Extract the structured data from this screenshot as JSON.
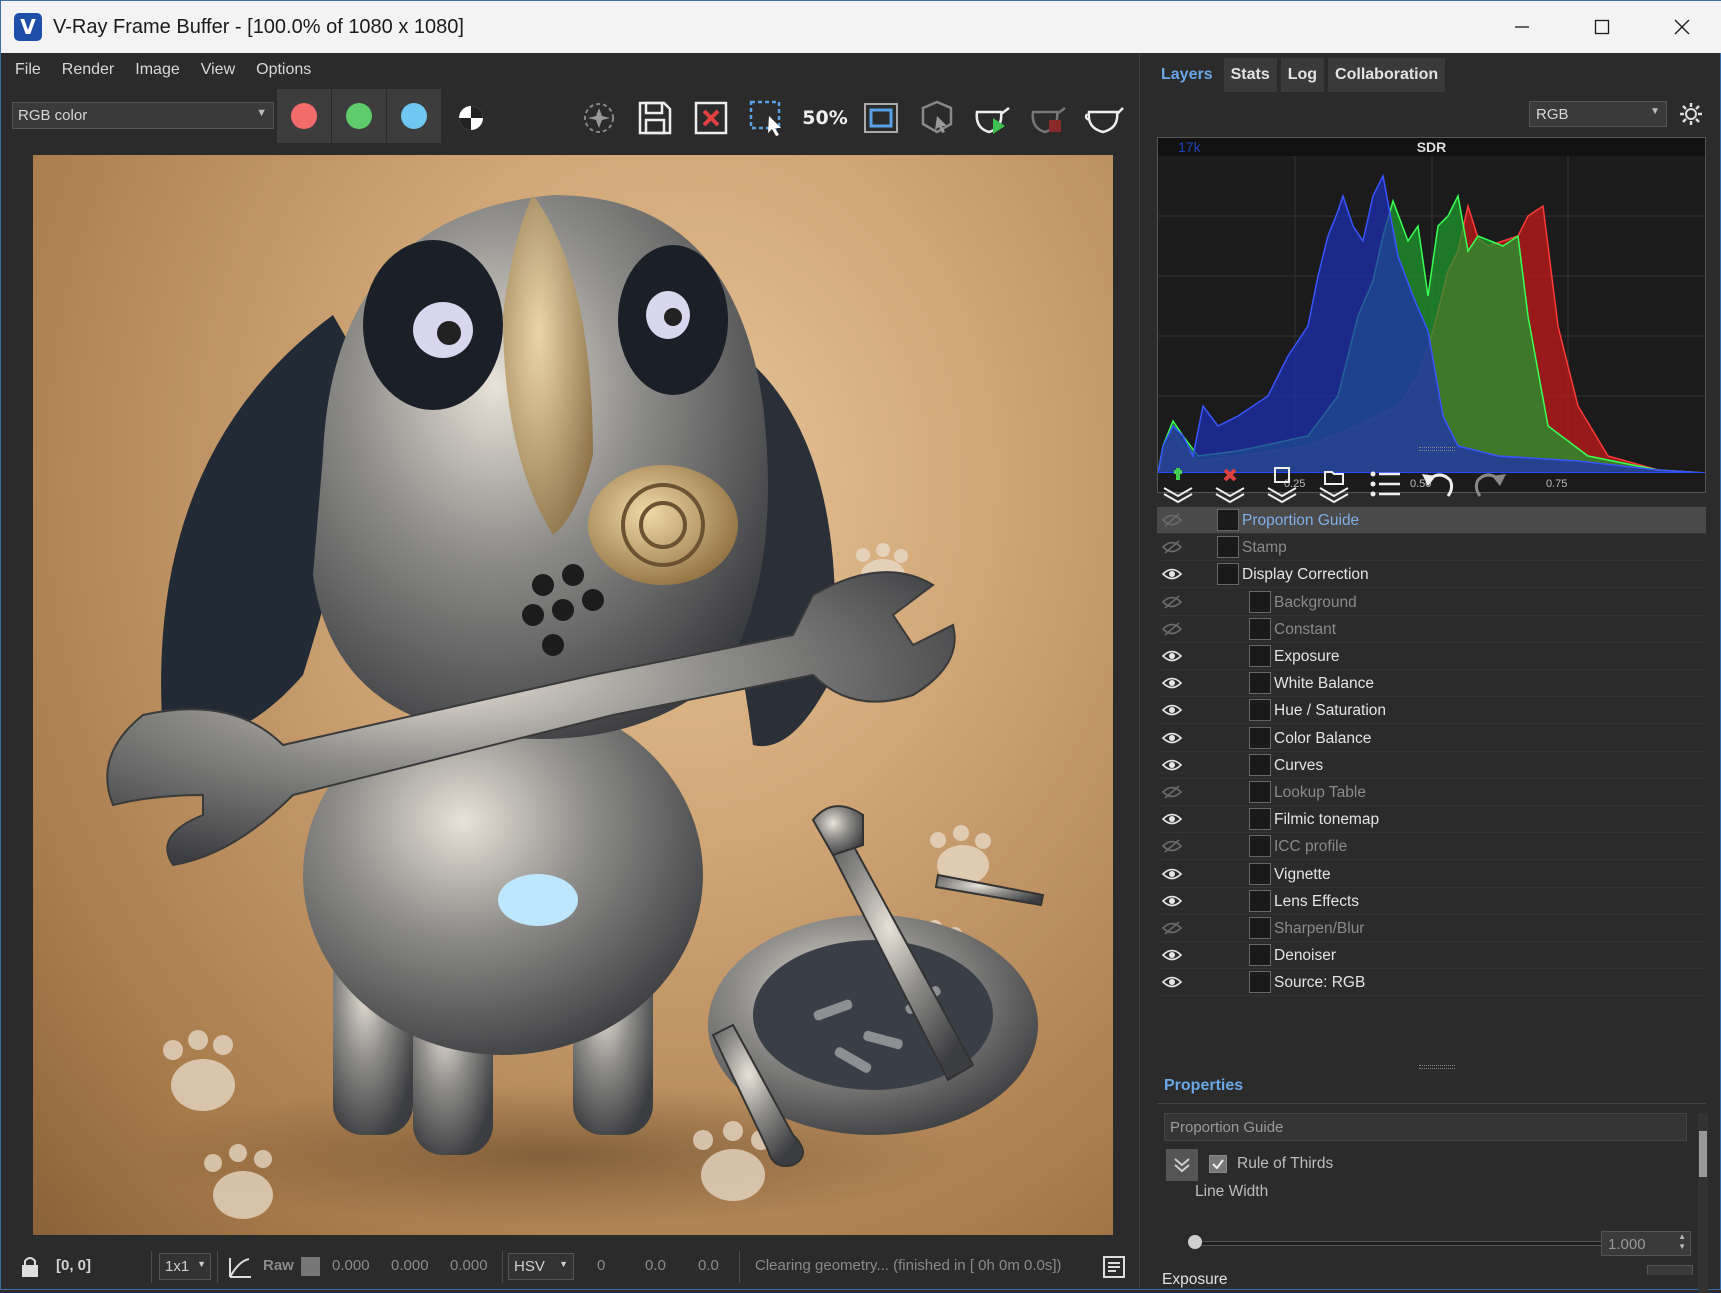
{
  "window": {
    "title": "V-Ray Frame Buffer - [100.0% of 1080 x 1080]",
    "logo_letter": "V"
  },
  "menu": [
    "File",
    "Render",
    "Image",
    "View",
    "Options"
  ],
  "toolbar": {
    "channel_value": "RGB color",
    "zoom_label": "50%",
    "colors": {
      "red": "#f26c6c",
      "green": "#5ecc6a",
      "blue": "#6ec8f2"
    }
  },
  "statusbar": {
    "coords": "[0, 0]",
    "sample_size": "1x1",
    "raw_label": "Raw",
    "rgb_values": [
      "0.000",
      "0.000",
      "0.000"
    ],
    "color_mode": "HSV",
    "hsv_values": [
      "0",
      "0.0",
      "0.0"
    ],
    "message": "Clearing geometry... (finished in [ 0h  0m  0.0s])"
  },
  "right_panel": {
    "tabs": [
      "Layers",
      "Stats",
      "Log",
      "Collaboration"
    ],
    "active_tab": "Layers",
    "histogram_channel": "RGB",
    "histogram": {
      "label": "SDR",
      "count": "17k",
      "ticks": [
        "0.25",
        "0.50",
        "0.75"
      ]
    },
    "layers": [
      {
        "name": "Proportion Guide",
        "visible": false,
        "indent": 0,
        "selected": true,
        "icon": "proportion-guide-icon"
      },
      {
        "name": "Stamp",
        "visible": false,
        "indent": 0,
        "icon": "stamp-icon"
      },
      {
        "name": "Display Correction",
        "visible": true,
        "indent": 0,
        "icon": "curve-icon"
      },
      {
        "name": "Background",
        "visible": false,
        "indent": 1,
        "icon": "background-icon"
      },
      {
        "name": "Constant",
        "visible": false,
        "indent": 1,
        "icon": "constant-icon"
      },
      {
        "name": "Exposure",
        "visible": true,
        "indent": 1,
        "icon": "exposure-icon"
      },
      {
        "name": "White Balance",
        "visible": true,
        "indent": 1,
        "icon": "white-balance-icon"
      },
      {
        "name": "Hue / Saturation",
        "visible": true,
        "indent": 1,
        "icon": "hue-saturation-icon"
      },
      {
        "name": "Color Balance",
        "visible": true,
        "indent": 1,
        "icon": "color-balance-icon"
      },
      {
        "name": "Curves",
        "visible": true,
        "indent": 1,
        "icon": "curves-icon"
      },
      {
        "name": "Lookup Table",
        "visible": false,
        "indent": 1,
        "icon": "lut-icon"
      },
      {
        "name": "Filmic tonemap",
        "visible": true,
        "indent": 1,
        "icon": "filmic-icon"
      },
      {
        "name": "ICC profile",
        "visible": false,
        "indent": 1,
        "icon": "icc-icon"
      },
      {
        "name": "Vignette",
        "visible": true,
        "indent": 1,
        "icon": "vignette-icon"
      },
      {
        "name": "Lens Effects",
        "visible": true,
        "indent": 1,
        "icon": "lens-effects-icon"
      },
      {
        "name": "Sharpen/Blur",
        "visible": false,
        "indent": 1,
        "icon": "sharpen-icon"
      },
      {
        "name": "Denoiser",
        "visible": true,
        "indent": 1,
        "icon": "denoiser-icon"
      },
      {
        "name": "Source: RGB",
        "visible": true,
        "indent": 1,
        "icon": "source-rgb-icon"
      }
    ],
    "properties": {
      "tab": "Properties",
      "title": "Proportion Guide",
      "checkbox_label": "Rule of Thirds",
      "line_width_label": "Line Width",
      "line_width_value": "1.000",
      "next_label": "Exposure"
    }
  }
}
